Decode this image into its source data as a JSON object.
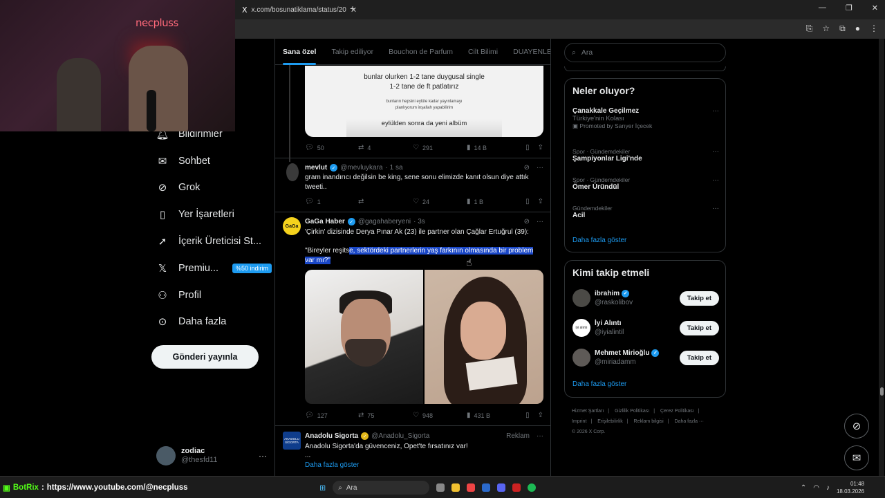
{
  "browser": {
    "tab_title": "x.com/bosunatiklama/status/20",
    "x_logo": "X",
    "close": "✕",
    "new_tab": "+"
  },
  "webcam": {
    "brand": "necpluss"
  },
  "nav": {
    "items": [
      {
        "label": "Bildirimler",
        "icon": "bell-icon"
      },
      {
        "label": "Sohbet",
        "icon": "mail-icon"
      },
      {
        "label": "Grok",
        "icon": "grok-icon"
      },
      {
        "label": "Yer İşaretleri",
        "icon": "bookmark-icon"
      },
      {
        "label": "İçerik Üreticisi St...",
        "icon": "rocket-icon"
      },
      {
        "label": "Premiu...",
        "icon": "x-icon",
        "badge": "%50 indirim"
      },
      {
        "label": "Profil",
        "icon": "person-icon"
      },
      {
        "label": "Daha fazla",
        "icon": "more-circle-icon"
      }
    ],
    "post_button": "Gönderi yayınla",
    "account": {
      "name": "zodiac",
      "handle": "@thesfd11",
      "more": "···"
    }
  },
  "main": {
    "tabs": [
      "Sana özel",
      "Takip ediliyor",
      "Bouchon de Parfum",
      "Cilt Bilimi",
      "DUAYENLER"
    ],
    "image_card": {
      "line1": "bunlar olurken 1-2 tane duygusal single",
      "line2": "1-2 tane de ft patlatırız",
      "line3": "bunların hepsini eylüle kadar yayınlamayı",
      "line4": "planlıyorum inşallah yapabilirim",
      "line5": "eylülden sonra da yeni albüm"
    },
    "actions1": {
      "reply": "50",
      "repost": "4",
      "like": "291",
      "views": "14 B"
    },
    "tweet2": {
      "name": "mevlut",
      "handle": "@mevluykara",
      "time": "· 1 sa",
      "text": "gram inandırıcı değilsin be king, sene sonu elimizde kanıt olsun diye attık tweeti..",
      "actions": {
        "reply": "1",
        "repost": "",
        "like": "24",
        "views": "1 B"
      }
    },
    "tweet3": {
      "name": "GaGa Haber",
      "handle": "@gagahaberyeni",
      "time": "· 3s",
      "avatar_text": "GaGa",
      "text1": "'Çirkin' dizisinde Derya Pınar Ak (23) ile partner olan Çağlar Ertuğrul (39):",
      "text2a": "\"Bireyler reşits",
      "text2b": "e, sektördeki partnerlerin yaş farkının olmasında bir problem var mı?\"",
      "actions": {
        "reply": "127",
        "repost": "75",
        "like": "948",
        "views": "431 B"
      }
    },
    "ad": {
      "name": "Anadolu Sigorta",
      "handle": "@Anadolu_Sigorta",
      "label": "Reklam",
      "avatar_text": "ANADOLU SİGORTA",
      "text": "Anadolu Sigorta'da güvenceniz, Opet'te fırsatınız var!",
      "ellipsis": "...",
      "show_more": "Daha fazla göster"
    }
  },
  "right": {
    "search_placeholder": "Ara",
    "trends_title": "Neler oluyor?",
    "trends": [
      {
        "meta": "",
        "title": "Çanakkale Geçilmez",
        "sub": "Türkiye'nin Kolası",
        "promo": "Promoted by Sarıyer İçecek"
      },
      {
        "meta": "Spor · Gündemdekiler",
        "title": "Şampiyonlar Ligi'nde"
      },
      {
        "meta": "Spor · Gündemdekiler",
        "title": "Ömer Üründül"
      },
      {
        "meta": "Gündemdekiler",
        "title": "Acil"
      }
    ],
    "trends_more": "Daha fazla göster",
    "who_title": "Kimi takip etmeli",
    "who": [
      {
        "name": "ibrahim",
        "handle": "@raskolibov",
        "verified": true,
        "button": "Takip et"
      },
      {
        "name": "İyi Alıntı",
        "handle": "@iyialintil",
        "verified": false,
        "button": "Takip et",
        "avatar_text": "iyi alıntı"
      },
      {
        "name": "Mehmet Mirioğlu",
        "handle": "@miriadamm",
        "verified": true,
        "button": "Takip et"
      }
    ],
    "who_more": "Daha fazla göster",
    "footer": [
      "Hizmet Şartları",
      "|",
      "Gizlilik Politikası",
      "|",
      "Çerez Politikası",
      "|",
      "Imprint",
      "|",
      "Erişilebilirlik",
      "|",
      "Reklam bilgisi",
      "|",
      "Daha fazla ···",
      "© 2026 X Corp."
    ]
  },
  "stream": {
    "botrix_name": "BotRix",
    "botrix_sep": ":",
    "botrix_text": "https://www.youtube.com/@necpluss"
  },
  "taskbar": {
    "search": "Ara",
    "time": "01:48",
    "date": "18.03.2026"
  },
  "colors": {
    "accent": "#1d9bf0",
    "bg": "#000000",
    "border": "#2f3336",
    "muted": "#71767b"
  }
}
